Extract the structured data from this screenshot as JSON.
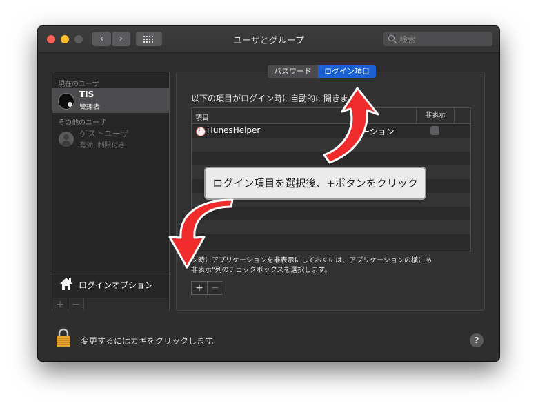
{
  "window": {
    "title": "ユーザとグループ",
    "search_placeholder": "検索",
    "nav_back": "‹",
    "nav_forward": "›"
  },
  "sidebar": {
    "current_user_header": "現在のユーザ",
    "current_user": {
      "name": "TIS",
      "role": "管理者"
    },
    "other_users_header": "その他のユーザ",
    "guest_user": {
      "name": "ゲストユーザ",
      "status": "有効, 制限付き"
    },
    "login_options_label": "ログインオプション",
    "add_label": "+",
    "remove_label": "−"
  },
  "tabs": [
    {
      "label": "パスワード",
      "selected": false
    },
    {
      "label": "ログイン項目",
      "selected": true
    }
  ],
  "main": {
    "description": "以下の項目がログイン時に自動的に開きま",
    "columns": {
      "item": "項目",
      "hide": "非表示"
    },
    "rows": [
      {
        "name": "iTunesHelper",
        "kind": "ケーション",
        "hidden": false
      }
    ],
    "note": "ン時にアプリケーションを非表示にしておくには、アプリケーションの横にあ\n非表示\"列のチェックボックスを選択します。",
    "add_label": "+",
    "remove_label": "−"
  },
  "footer": {
    "lock_text": "変更するにはカギをクリックします。",
    "help_label": "?"
  },
  "annotation": {
    "callout_text": "ログイン項目を選択後、+ボタンをクリック",
    "arrow_color": "#ef2b2b"
  },
  "colors": {
    "accent": "#1a62d4",
    "traffic_close": "#fd5f57",
    "traffic_minimize": "#febc2e",
    "traffic_zoom": "#5d5d5f"
  }
}
